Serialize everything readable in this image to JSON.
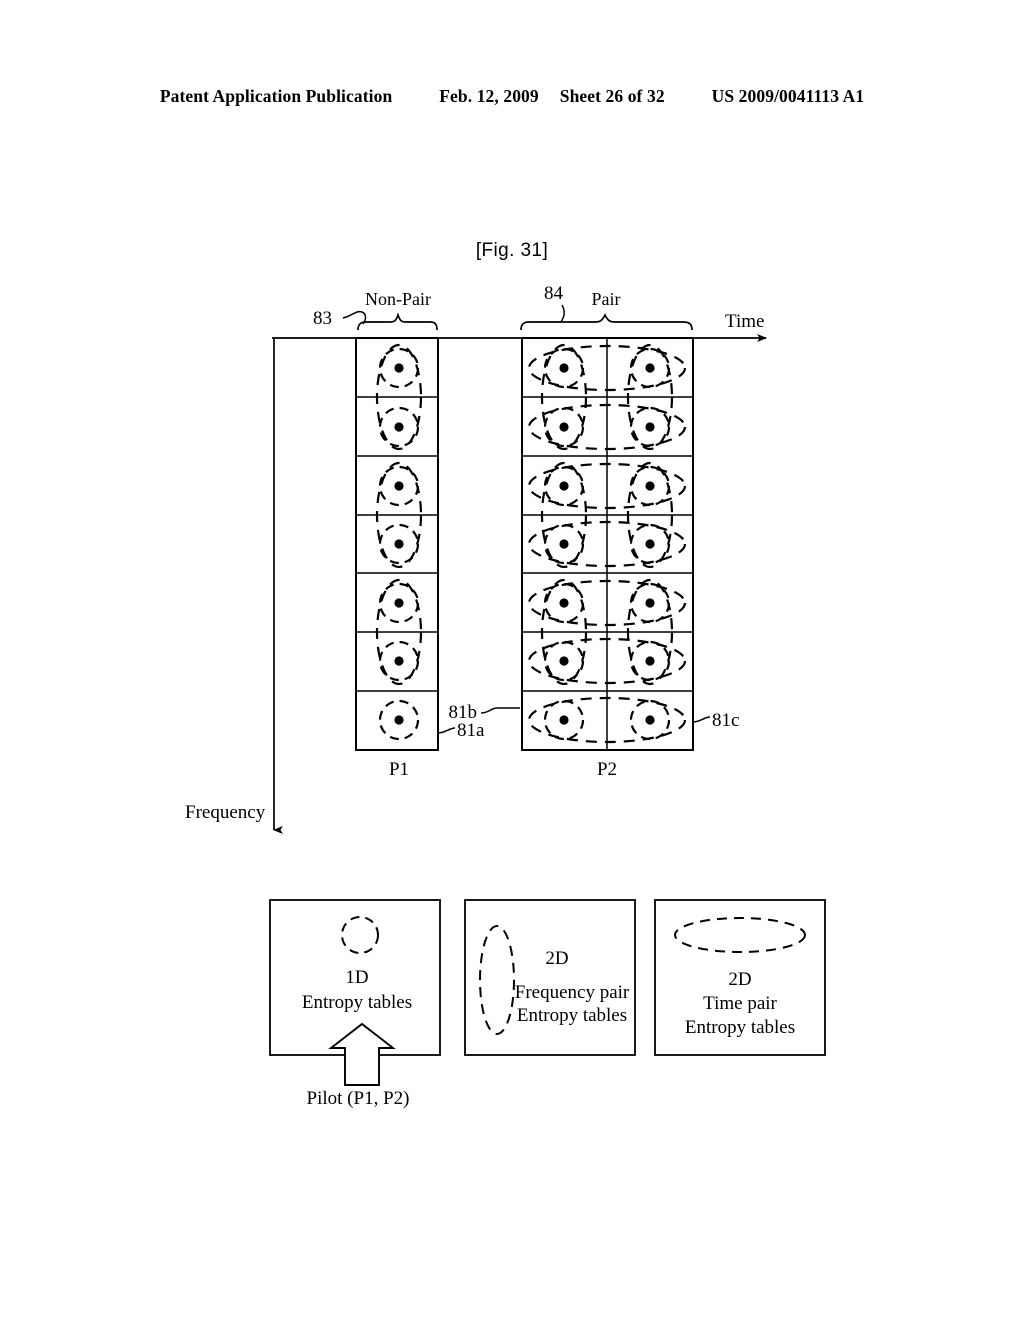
{
  "header": {
    "publication": "Patent Application Publication",
    "date": "Feb. 12, 2009",
    "sheet": "Sheet 26 of 32",
    "doc_number": "US 2009/0041113 A1"
  },
  "figure": {
    "label": "[Fig. 31]",
    "axes": {
      "time_label": "Time",
      "frequency_label": "Frequency"
    },
    "groups": [
      {
        "ref": "83",
        "label": "Non-Pair",
        "column_label": "P1"
      },
      {
        "ref": "84",
        "label": "Pair",
        "column_label": "P2"
      }
    ],
    "callouts": [
      {
        "ref": "81a"
      },
      {
        "ref": "81b"
      },
      {
        "ref": "81c"
      }
    ],
    "grid": {
      "rows": 7,
      "p1_columns": 1,
      "p2_columns": 2,
      "pair_row_spans": [
        [
          1,
          2
        ],
        [
          3,
          4
        ],
        [
          5,
          6
        ]
      ],
      "last_row_single": true
    }
  },
  "legend": {
    "boxes": [
      {
        "name": "1d-entropy-tables",
        "shape": "circle",
        "line1": "1D",
        "line2": "Entropy tables",
        "line3": ""
      },
      {
        "name": "2d-frequency-pair-entropy-tables",
        "shape": "vertical-ellipse",
        "line1": "2D",
        "line2": "Frequency pair",
        "line3": "Entropy tables"
      },
      {
        "name": "2d-time-pair-entropy-tables",
        "shape": "horizontal-ellipse",
        "line1": "2D",
        "line2": "Time pair",
        "line3": "Entropy tables"
      }
    ],
    "input_label": "Pilot (P1, P2)"
  },
  "colors": {
    "ink": "#000000",
    "paper": "#ffffff"
  }
}
